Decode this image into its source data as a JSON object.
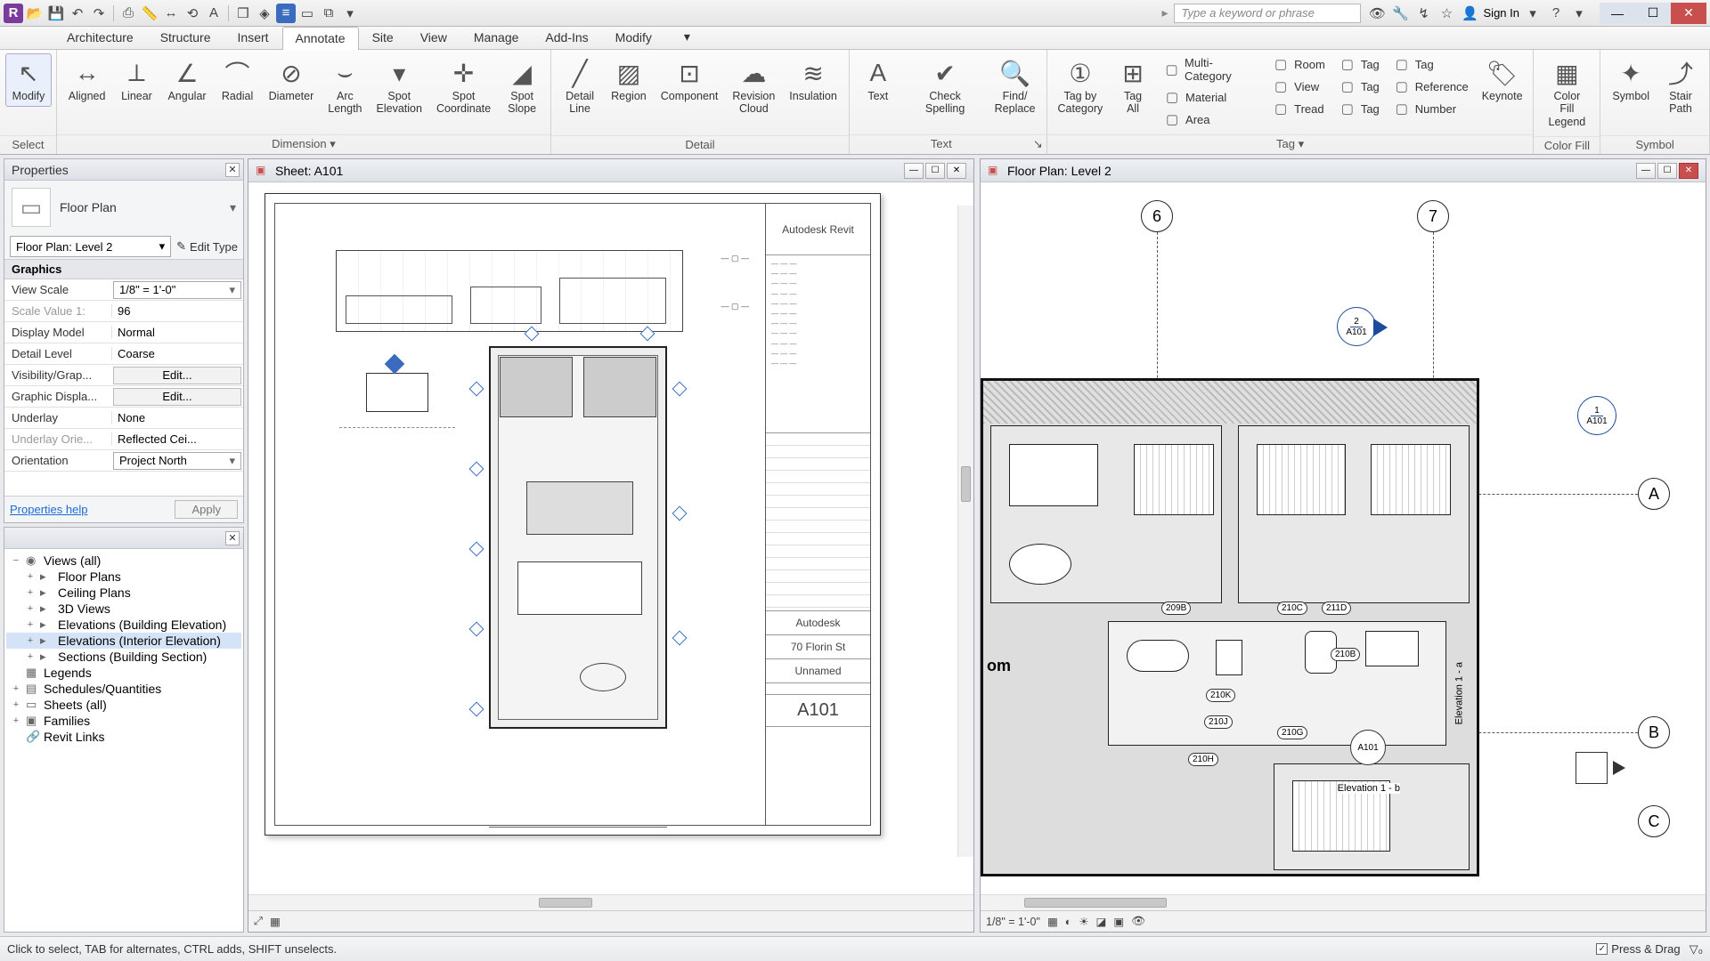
{
  "titlebar": {
    "search_placeholder": "Type a keyword or phrase",
    "signin": "Sign In"
  },
  "menutabs": [
    "Architecture",
    "Structure",
    "Insert",
    "Annotate",
    "Site",
    "View",
    "Manage",
    "Add-Ins",
    "Modify"
  ],
  "menutabs_active": 3,
  "ribbon": {
    "select": {
      "label": "Select",
      "modify": "Modify"
    },
    "dimension": {
      "label": "Dimension",
      "buttons": [
        "Aligned",
        "Linear",
        "Angular",
        "Radial",
        "Diameter",
        "Arc\nLength",
        "Spot\nElevation",
        "Spot\nCoordinate",
        "Spot\nSlope"
      ]
    },
    "detail": {
      "label": "Detail",
      "buttons": [
        "Detail\nLine",
        "Region",
        "Component",
        "Revision\nCloud",
        "Insulation"
      ]
    },
    "text": {
      "label": "Text",
      "buttons": [
        "Text",
        "Check Spelling",
        "Find/\nReplace"
      ]
    },
    "tag": {
      "label": "Tag",
      "big": [
        "Tag by\nCategory",
        "Tag\nAll"
      ],
      "small": [
        {
          "icon": "multi",
          "label": "Multi- Category"
        },
        {
          "icon": "material",
          "label": "Material"
        },
        {
          "icon": "area",
          "label": "Area"
        },
        {
          "icon": "room",
          "label": "Room"
        },
        {
          "icon": "view",
          "label": "View"
        },
        {
          "icon": "tread",
          "label": "Tread"
        },
        {
          "icon": "tag",
          "label": "Tag"
        },
        {
          "icon": "tag",
          "label": "Tag"
        },
        {
          "icon": "tag",
          "label": "Tag"
        },
        {
          "icon": "tag",
          "label": "Tag"
        },
        {
          "icon": "ref",
          "label": "Reference"
        },
        {
          "icon": "num",
          "label": "Number"
        }
      ],
      "keynote": "Keynote"
    },
    "colorfill": {
      "label": "Color Fill",
      "btn": "Color Fill\nLegend"
    },
    "symbol": {
      "label": "Symbol",
      "buttons": [
        "Symbol",
        "Stair\nPath"
      ]
    }
  },
  "properties": {
    "title": "Properties",
    "type_name": "Floor Plan",
    "instance": "Floor Plan: Level 2",
    "edit_type": "Edit Type",
    "section": "Graphics",
    "rows": [
      {
        "k": "View Scale",
        "v": "1/8\" = 1'-0\"",
        "combo": true
      },
      {
        "k": "Scale Value    1:",
        "v": "96",
        "dim": true
      },
      {
        "k": "Display Model",
        "v": "Normal"
      },
      {
        "k": "Detail Level",
        "v": "Coarse"
      },
      {
        "k": "Visibility/Grap...",
        "v": "Edit...",
        "btn": true
      },
      {
        "k": "Graphic Displa...",
        "v": "Edit...",
        "btn": true
      },
      {
        "k": "Underlay",
        "v": "None"
      },
      {
        "k": "Underlay Orie...",
        "v": "Reflected Cei...",
        "dim": true
      },
      {
        "k": "Orientation",
        "v": "Project North",
        "combo": true
      }
    ],
    "help": "Properties help",
    "apply": "Apply"
  },
  "browser": {
    "nodes": [
      {
        "label": "Views (all)",
        "icon": "views",
        "exp": "−",
        "lvl": 0
      },
      {
        "label": "Floor Plans",
        "icon": "folder",
        "exp": "+",
        "lvl": 1
      },
      {
        "label": "Ceiling Plans",
        "icon": "folder",
        "exp": "+",
        "lvl": 1
      },
      {
        "label": "3D Views",
        "icon": "folder",
        "exp": "+",
        "lvl": 1
      },
      {
        "label": "Elevations (Building Elevation)",
        "icon": "folder",
        "exp": "+",
        "lvl": 1
      },
      {
        "label": "Elevations (Interior Elevation)",
        "icon": "folder",
        "exp": "+",
        "lvl": 1,
        "sel": true
      },
      {
        "label": "Sections (Building Section)",
        "icon": "folder",
        "exp": "+",
        "lvl": 1
      },
      {
        "label": "Legends",
        "icon": "legend",
        "exp": "",
        "lvl": 0
      },
      {
        "label": "Schedules/Quantities",
        "icon": "sched",
        "exp": "+",
        "lvl": 0
      },
      {
        "label": "Sheets (all)",
        "icon": "sheet",
        "exp": "+",
        "lvl": 0
      },
      {
        "label": "Families",
        "icon": "fam",
        "exp": "+",
        "lvl": 0
      },
      {
        "label": "Revit Links",
        "icon": "link",
        "exp": "",
        "lvl": 0
      }
    ]
  },
  "viewport_left": {
    "title": "Sheet: A101",
    "titleblock": {
      "product": "Autodesk Revit",
      "company": "Autodesk",
      "address": "70 Florin St",
      "project": "Unnamed",
      "sheet_no": "A101"
    }
  },
  "viewport_right": {
    "title": "Floor Plan: Level 2",
    "grids_top": [
      "6",
      "7"
    ],
    "grids_right": [
      "A",
      "B",
      "C"
    ],
    "refs": [
      {
        "num": "2",
        "sheet": "A101"
      },
      {
        "num": "1",
        "sheet": "A101"
      }
    ],
    "door_tags": [
      "209B",
      "210C",
      "211D",
      "210B",
      "210K",
      "210J",
      "210G",
      "210H",
      "A101"
    ],
    "room_label": "om",
    "elev_label_a": "Elevation 1 - a",
    "elev_label_b": "Elevation 1 - b",
    "scale": "1/8\" = 1'-0\""
  },
  "statusbar": {
    "hint": "Click to select, TAB for alternates, CTRL adds, SHIFT unselects.",
    "pressdrag": "Press & Drag"
  }
}
